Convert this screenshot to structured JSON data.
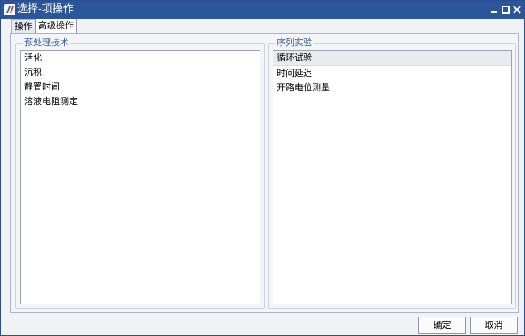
{
  "window": {
    "title": "选择-项操作"
  },
  "tabs": [
    {
      "label": "操作"
    },
    {
      "label": "高级操作"
    }
  ],
  "left_group": {
    "label": "预处理技术",
    "items": [
      {
        "label": "活化"
      },
      {
        "label": "沉积"
      },
      {
        "label": "静置时间"
      },
      {
        "label": "溶液电阻测定"
      }
    ]
  },
  "right_group": {
    "label": "序列实验",
    "items": [
      {
        "label": "循环试验"
      },
      {
        "label": "时间延迟"
      },
      {
        "label": "开路电位测量"
      }
    ]
  },
  "buttons": {
    "ok": "确定",
    "cancel": "取消"
  },
  "colors": {
    "titlebar": "#2b579a",
    "group_label": "#3b62a3",
    "selected_item": "#e8ecf1"
  }
}
